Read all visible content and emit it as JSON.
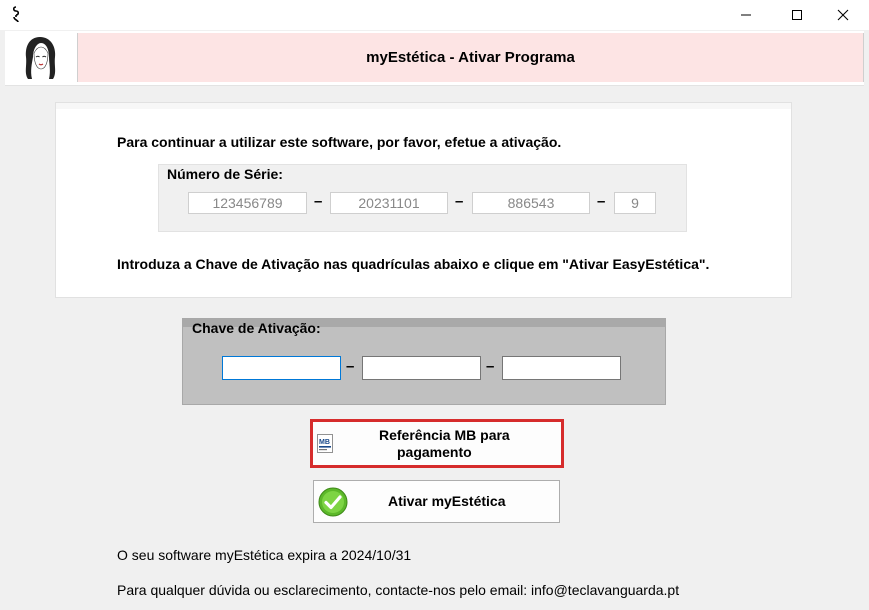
{
  "window": {
    "title_icon": "cursor-icon",
    "controls": {
      "minimize": "—",
      "maximize": "☐",
      "close": "✕"
    }
  },
  "header": {
    "title": "myEstética  -  Ativar Programa",
    "logo_icon": "woman-face-icon"
  },
  "info": {
    "intro": "Para continuar a utilizar este software, por favor, efetue a ativação.",
    "instructions": "Introduza a Chave de Ativação nas quadrículas abaixo e clique em \"Ativar EasyEstética\"."
  },
  "serial": {
    "label": "Número de Série:",
    "parts": [
      "123456789",
      "20231101",
      "886543",
      "9"
    ],
    "separator": "–"
  },
  "activation_key": {
    "label": "Chave de Ativação:",
    "values": [
      "",
      "",
      ""
    ],
    "separator": "–"
  },
  "buttons": {
    "mb_reference": {
      "label_line1": "Referência MB para",
      "label_line2": "pagamento",
      "icon": "multibanco-icon"
    },
    "activate": {
      "label": "Ativar myEstética",
      "icon": "check-circle-icon"
    }
  },
  "footer": {
    "expiry": "O seu software myEstética expira a 2024/10/31",
    "contact": "Para qualquer dúvida ou esclarecimento, contacte-nos pelo email: info@teclavanguarda.pt"
  },
  "colors": {
    "header_bg": "#fde4e4",
    "highlight_border": "#d62c2c",
    "check_green": "#5cb82a"
  }
}
